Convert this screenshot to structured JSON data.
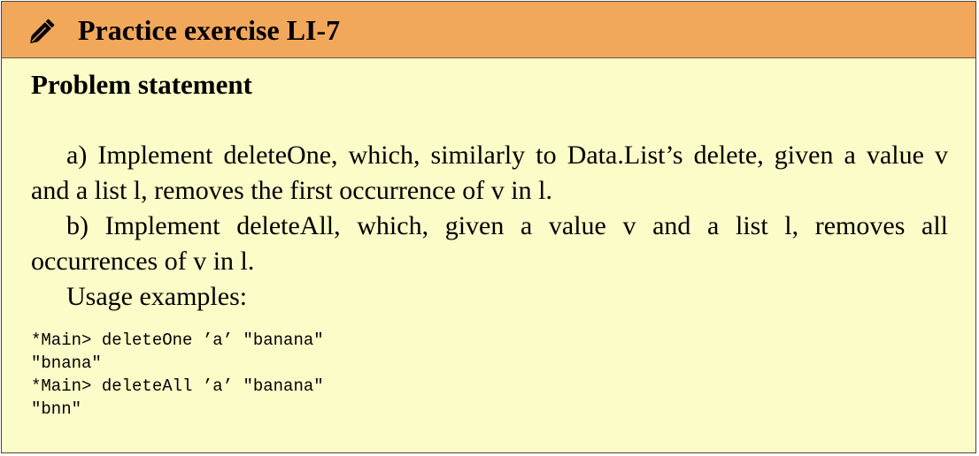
{
  "header": {
    "icon": "pencil-icon",
    "title": "Practice exercise LI-7",
    "background_color": "#f2a85b"
  },
  "body": {
    "background_color": "#fcfcc8",
    "section_title": "Problem statement",
    "paragraphs": [
      "a) Implement deleteOne, which, similarly to Data.List’s delete, given a value v and a list l, removes the first occurrence of v in l.",
      "b) Implement deleteAll, which, given a value v and a list l, removes all occurrences of v in l.",
      "Usage examples:"
    ],
    "code_lines": [
      "*Main> deleteOne ’a’ \"banana\"",
      "\"bnana\"",
      "*Main> deleteAll ’a’ \"banana\"",
      "\"bnn\""
    ]
  }
}
